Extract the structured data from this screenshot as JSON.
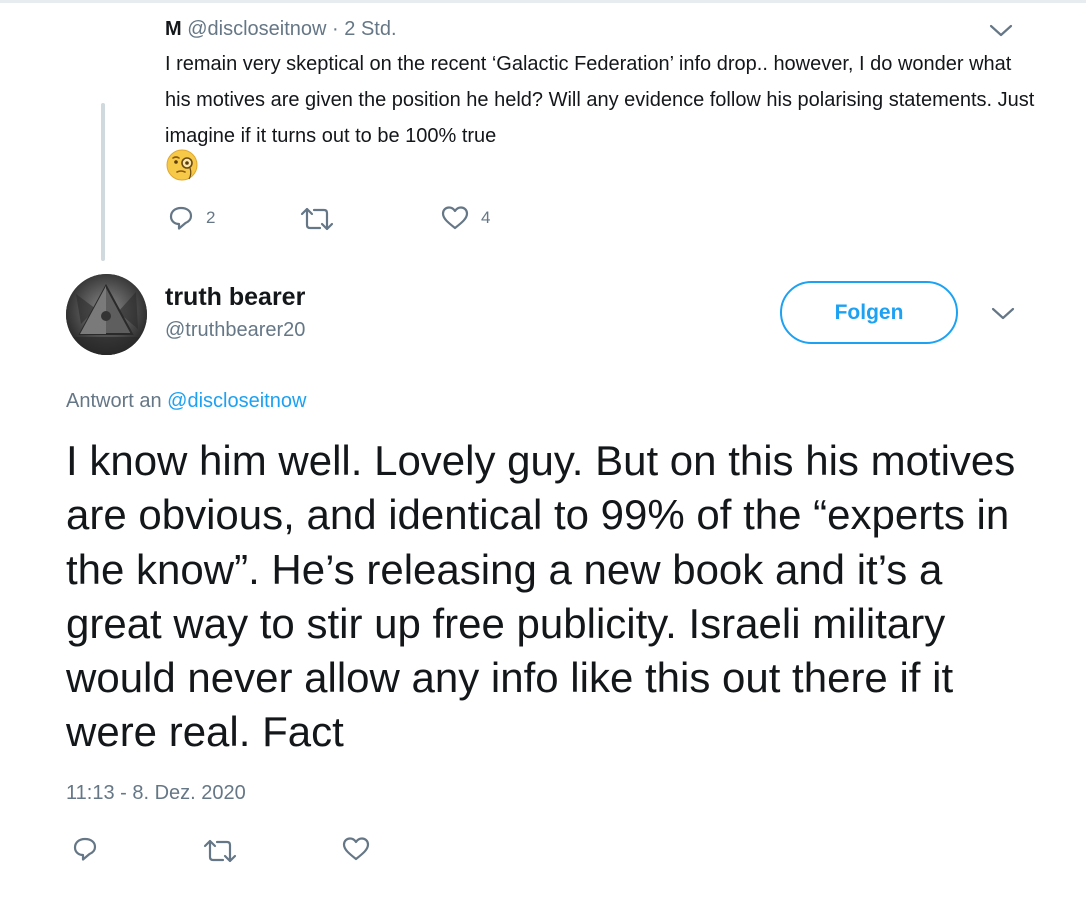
{
  "parent_tweet": {
    "author_initial": "M",
    "handle": "@discloseitnow",
    "separator": " · ",
    "time": "2 Std.",
    "text": "I remain very skeptical on the recent ‘Galactic Federation’ info drop.. however, I do wonder what his motives are given the position he held? Will any evidence follow his polarising statements. Just imagine if it turns out to be 100% true",
    "emoji": "face-with-monocle-icon",
    "reply_count": "2",
    "like_count": "4"
  },
  "main_tweet": {
    "display_name": "truth bearer",
    "handle": "@truthbearer20",
    "follow_label": "Folgen",
    "reply_prefix": "Antwort an ",
    "reply_handle": "@discloseitnow",
    "text": "I know him well. Lovely guy. But on this his motives are obvious, and identical to 99% of the “experts in the know”. He’s releasing a new book and it’s a great way to stir up free publicity. Israeli military would never allow any info like this out there if it were real. Fact",
    "timestamp": "11:13 - 8. Dez. 2020"
  },
  "colors": {
    "text": "#14171a",
    "secondary": "#657786",
    "accent": "#1da1f2",
    "thread_line": "#cfd9de",
    "emoji_face": "#f7c948"
  }
}
